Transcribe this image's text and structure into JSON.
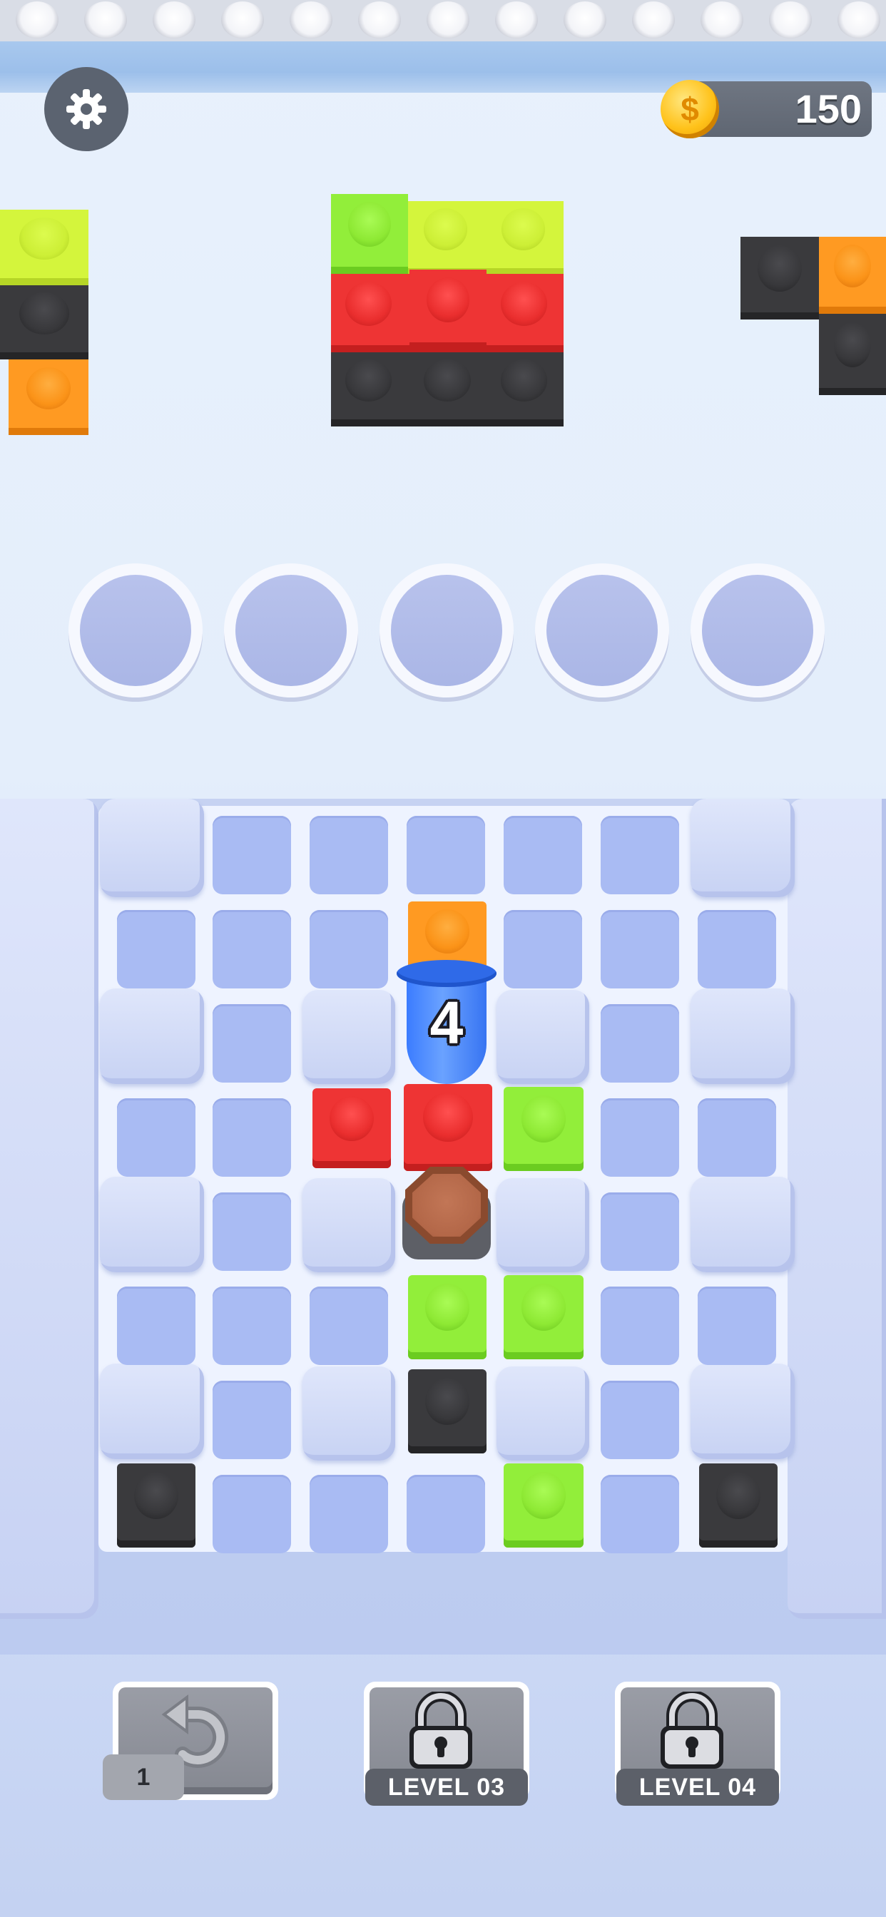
{
  "header": {
    "coins": "150",
    "coin_symbol": "$"
  },
  "cup": {
    "count": "4",
    "color": "#3b7cff"
  },
  "slots": {
    "count": 5,
    "filled": 0
  },
  "upper_shelf": {
    "left_stack": [
      "lime",
      "black",
      "orange"
    ],
    "center_stack": {
      "top_row": [
        "green",
        "lime",
        "lime"
      ],
      "middle_row": [
        "red",
        "red",
        "red"
      ],
      "bottom_row": [
        "black",
        "black",
        "black"
      ]
    },
    "right_stack": [
      "black",
      "orange",
      "black"
    ]
  },
  "board": {
    "bricks": [
      "orange",
      "red",
      "red",
      "green",
      "green",
      "green",
      "black",
      "green",
      "black",
      "black"
    ]
  },
  "bottom_bar": {
    "undo": {
      "count": "1",
      "icon": "undo-arrow-icon"
    },
    "locked_1": {
      "label": "LEVEL 03",
      "icon": "padlock-icon"
    },
    "locked_2": {
      "label": "LEVEL 04",
      "icon": "padlock-icon"
    }
  },
  "colors": {
    "lime": "#d4f53c",
    "green": "#92ee3a",
    "red": "#ee3434",
    "black": "#3a3a3d",
    "orange": "#ff9a22",
    "cup_blue": "#3b7cff",
    "coin_gold": "#ffc21a"
  }
}
